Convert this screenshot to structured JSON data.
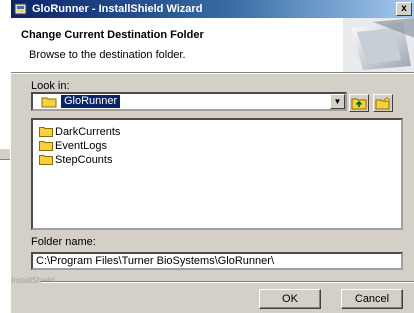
{
  "window": {
    "title": "GloRunner - InstallShield Wizard",
    "close_label": "x"
  },
  "header": {
    "title": "Change Current Destination Folder",
    "subtitle": "Browse to the destination folder."
  },
  "look_in": {
    "label": "Look in:",
    "value": "GloRunner",
    "arrow": "▼"
  },
  "toolbar": {
    "up_icon": "up-folder-icon",
    "new_icon": "new-folder-icon"
  },
  "folders": [
    {
      "name": "DarkCurrents",
      "icon": "folder-icon"
    },
    {
      "name": "EventLogs",
      "icon": "folder-icon"
    },
    {
      "name": "StepCounts",
      "icon": "folder-icon"
    }
  ],
  "folder_name": {
    "label": "Folder name:",
    "value": "C:\\Program Files\\Turner BioSystems\\GloRunner\\"
  },
  "footer": {
    "brand": "InstallShield"
  },
  "buttons": {
    "ok": "OK",
    "cancel": "Cancel"
  },
  "colors": {
    "titlebar_start": "#0a246a",
    "titlebar_end": "#a6caf0",
    "selection": "#0a246a",
    "face": "#d4d0c8",
    "folder": "#f5d142"
  }
}
